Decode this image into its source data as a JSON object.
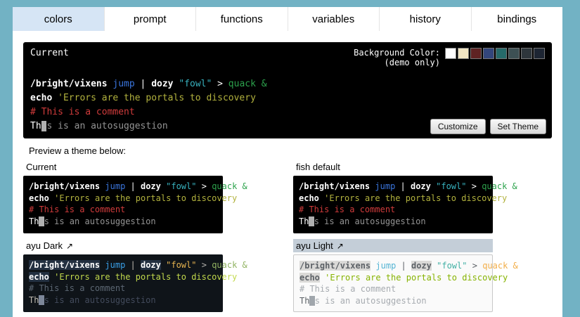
{
  "tabs": {
    "items": [
      {
        "label": "colors",
        "active": true
      },
      {
        "label": "prompt",
        "active": false
      },
      {
        "label": "functions",
        "active": false
      },
      {
        "label": "variables",
        "active": false
      },
      {
        "label": "history",
        "active": false
      },
      {
        "label": "bindings",
        "active": false
      }
    ]
  },
  "main_terminal": {
    "title": "Current",
    "background_color_label": "Background Color:",
    "demo_only_label": "(demo only)",
    "swatches": [
      "#ffffff",
      "#f1e5c3",
      "#5f2323",
      "#33467c",
      "#266a6a",
      "#3d5054",
      "#2e363c",
      "#1d2533"
    ],
    "customize_button": "Customize",
    "set_theme_button": "Set Theme",
    "theme": "current"
  },
  "preview_heading": "Preview a theme below:",
  "ui": {
    "external_link_symbol": "↗"
  },
  "sample_lines": [
    {
      "segments": [
        {
          "text": "/bright/vixens",
          "role": "command"
        },
        {
          "text": " ",
          "role": "normal"
        },
        {
          "text": "jump",
          "role": "param"
        },
        {
          "text": " | ",
          "role": "normal"
        },
        {
          "text": "dozy",
          "role": "command"
        },
        {
          "text": " ",
          "role": "normal"
        },
        {
          "text": "\"fowl\"",
          "role": "quote"
        },
        {
          "text": " ",
          "role": "normal"
        },
        {
          "text": ">",
          "role": "redirect"
        },
        {
          "text": " ",
          "role": "normal"
        },
        {
          "text": "quack",
          "role": "end"
        },
        {
          "text": " ",
          "role": "normal"
        },
        {
          "text": "&",
          "role": "end"
        }
      ]
    },
    {
      "segments": [
        {
          "text": "echo",
          "role": "command"
        },
        {
          "text": " ",
          "role": "normal"
        },
        {
          "text": "'Errors are the portals to discovery",
          "role": "quoteline"
        }
      ]
    },
    {
      "segments": [
        {
          "text": "# This is a comment",
          "role": "comment"
        }
      ]
    },
    {
      "segments": [
        {
          "text": "Th",
          "role": "normal"
        },
        {
          "text": "i",
          "role": "cursor"
        },
        {
          "text": "s is an autosuggestion",
          "role": "autosuggestion"
        }
      ]
    }
  ],
  "themes": {
    "current": {
      "bg": "#000000",
      "colors": {
        "normal": "#ffffff",
        "command": "#ffffff",
        "command_bg": "transparent",
        "param": "#3a75dd",
        "quote": "#38b2bf",
        "redirect": "#ffffff",
        "end": "#2ca24c",
        "quoteline": "#b2b23e",
        "comment": "#d03b3b",
        "autosuggestion": "#949494",
        "cursor": "#b0b0b0"
      }
    },
    "fishdefault": {
      "bg": "#000000",
      "colors": {
        "normal": "#ffffff",
        "command": "#ffffff",
        "command_bg": "transparent",
        "param": "#3a75dd",
        "quote": "#38b2bf",
        "redirect": "#ffffff",
        "end": "#2ca24c",
        "quoteline": "#b2b23e",
        "comment": "#d03b3b",
        "autosuggestion": "#949494",
        "cursor": "#b0b0b0"
      }
    },
    "ayudark": {
      "bg": "#0f1419",
      "colors": {
        "normal": "#bfbab0",
        "command": "#ffffff",
        "command_bg": "#233041",
        "param": "#399ee6",
        "quote": "#e6b450",
        "redirect": "#b3b1ad",
        "end": "#91b362",
        "quoteline": "#c2d94c",
        "comment": "#5c6773",
        "autosuggestion": "#434b5c",
        "cursor": "#7d8799"
      }
    },
    "ayulight": {
      "bg": "#fafafa",
      "border": "#c8c8c8",
      "colors": {
        "normal": "#5c6166",
        "command": "#5c6166",
        "command_bg": "#dad9d7",
        "param": "#55b4d4",
        "quote": "#41b0a4",
        "redirect": "#5c6166",
        "end": "#f2ae49",
        "quoteline": "#86b300",
        "comment": "#a6abb0",
        "autosuggestion": "#a6abb0",
        "cursor": "#a0a6ac"
      }
    }
  },
  "theme_tiles": [
    {
      "name": "Current",
      "theme": "current",
      "external": false,
      "selected": false
    },
    {
      "name": "fish default",
      "theme": "fishdefault",
      "external": false,
      "selected": false
    },
    {
      "name": "ayu Dark",
      "theme": "ayudark",
      "external": true,
      "selected": false
    },
    {
      "name": "ayu Light",
      "theme": "ayulight",
      "external": true,
      "selected": true
    }
  ]
}
